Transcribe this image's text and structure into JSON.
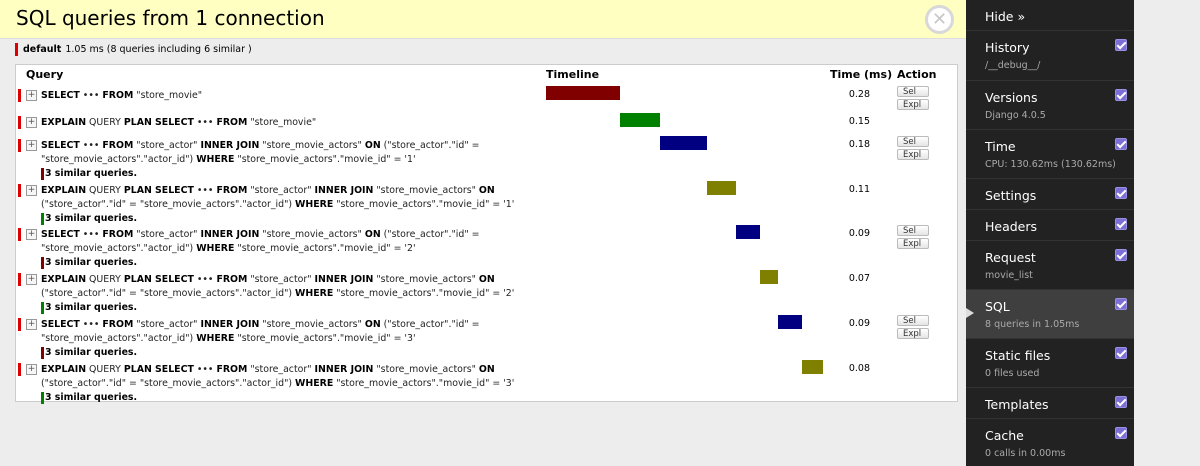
{
  "panel": {
    "title": "SQL queries from 1 connection",
    "close_icon": "close-icon",
    "connection": {
      "alias": "default",
      "summary": "1.05 ms (8 queries including 6 similar )"
    },
    "headers": {
      "query": "Query",
      "timeline": "Timeline",
      "time": "Time (ms)",
      "action": "Action"
    },
    "sel_label": "Sel",
    "expl_label": "Expl",
    "queries": [
      {
        "parts": [
          [
            "b",
            "SELECT"
          ],
          [
            "t",
            " ••• "
          ],
          [
            "b",
            "FROM"
          ],
          [
            "t",
            " \"store_movie\""
          ]
        ],
        "similar": "",
        "time": "0.28",
        "bar_color": "#800000",
        "bar_start": 0.0,
        "bar_end": 0.267,
        "actions": true
      },
      {
        "parts": [
          [
            "b",
            "EXPLAIN"
          ],
          [
            "t",
            " QUERY "
          ],
          [
            "b",
            "PLAN SELECT"
          ],
          [
            "t",
            " ••• "
          ],
          [
            "b",
            "FROM"
          ],
          [
            "t",
            " \"store_movie\""
          ]
        ],
        "similar": "",
        "time": "0.15",
        "bar_color": "#008000",
        "bar_start": 0.267,
        "bar_end": 0.41,
        "actions": false
      },
      {
        "parts": [
          [
            "b",
            "SELECT"
          ],
          [
            "t",
            " ••• "
          ],
          [
            "b",
            "FROM"
          ],
          [
            "t",
            " \"store_actor\" "
          ],
          [
            "b",
            "INNER JOIN"
          ],
          [
            "t",
            " \"store_movie_actors\" "
          ],
          [
            "b",
            "ON"
          ],
          [
            "t",
            " (\"store_actor\".\"id\" = \"store_movie_actors\".\"actor_id\") "
          ],
          [
            "b",
            "WHERE"
          ],
          [
            "t",
            " \"store_movie_actors\".\"movie_id\" = '1'"
          ]
        ],
        "similar": "3 similar queries.",
        "sim_color": "#800000",
        "time": "0.18",
        "bar_color": "#000080",
        "bar_start": 0.41,
        "bar_end": 0.581,
        "actions": true
      },
      {
        "parts": [
          [
            "b",
            "EXPLAIN"
          ],
          [
            "t",
            " QUERY "
          ],
          [
            "b",
            "PLAN SELECT"
          ],
          [
            "t",
            " ••• "
          ],
          [
            "b",
            "FROM"
          ],
          [
            "t",
            " \"store_actor\" "
          ],
          [
            "b",
            "INNER JOIN"
          ],
          [
            "t",
            " \"store_movie_actors\" "
          ],
          [
            "b",
            "ON"
          ],
          [
            "t",
            " (\"store_actor\".\"id\" = \"store_movie_actors\".\"actor_id\") "
          ],
          [
            "b",
            "WHERE"
          ],
          [
            "t",
            " \"store_movie_actors\".\"movie_id\" = '1'"
          ]
        ],
        "similar": "3 similar queries.",
        "sim_color": "#008000",
        "time": "0.11",
        "bar_color": "#808000",
        "bar_start": 0.581,
        "bar_end": 0.686,
        "actions": false
      },
      {
        "parts": [
          [
            "b",
            "SELECT"
          ],
          [
            "t",
            " ••• "
          ],
          [
            "b",
            "FROM"
          ],
          [
            "t",
            " \"store_actor\" "
          ],
          [
            "b",
            "INNER JOIN"
          ],
          [
            "t",
            " \"store_movie_actors\" "
          ],
          [
            "b",
            "ON"
          ],
          [
            "t",
            " (\"store_actor\".\"id\" = \"store_movie_actors\".\"actor_id\") "
          ],
          [
            "b",
            "WHERE"
          ],
          [
            "t",
            " \"store_movie_actors\".\"movie_id\" = '2'"
          ]
        ],
        "similar": "3 similar queries.",
        "sim_color": "#800000",
        "time": "0.09",
        "bar_color": "#000080",
        "bar_start": 0.686,
        "bar_end": 0.771,
        "actions": true
      },
      {
        "parts": [
          [
            "b",
            "EXPLAIN"
          ],
          [
            "t",
            " QUERY "
          ],
          [
            "b",
            "PLAN SELECT"
          ],
          [
            "t",
            " ••• "
          ],
          [
            "b",
            "FROM"
          ],
          [
            "t",
            " \"store_actor\" "
          ],
          [
            "b",
            "INNER JOIN"
          ],
          [
            "t",
            " \"store_movie_actors\" "
          ],
          [
            "b",
            "ON"
          ],
          [
            "t",
            " (\"store_actor\".\"id\" = \"store_movie_actors\".\"actor_id\") "
          ],
          [
            "b",
            "WHERE"
          ],
          [
            "t",
            " \"store_movie_actors\".\"movie_id\" = '2'"
          ]
        ],
        "similar": "3 similar queries.",
        "sim_color": "#008000",
        "time": "0.07",
        "bar_color": "#808000",
        "bar_start": 0.771,
        "bar_end": 0.838,
        "actions": false
      },
      {
        "parts": [
          [
            "b",
            "SELECT"
          ],
          [
            "t",
            " ••• "
          ],
          [
            "b",
            "FROM"
          ],
          [
            "t",
            " \"store_actor\" "
          ],
          [
            "b",
            "INNER JOIN"
          ],
          [
            "t",
            " \"store_movie_actors\" "
          ],
          [
            "b",
            "ON"
          ],
          [
            "t",
            " (\"store_actor\".\"id\" = \"store_movie_actors\".\"actor_id\") "
          ],
          [
            "b",
            "WHERE"
          ],
          [
            "t",
            " \"store_movie_actors\".\"movie_id\" = '3'"
          ]
        ],
        "similar": "3 similar queries.",
        "sim_color": "#800000",
        "time": "0.09",
        "bar_color": "#000080",
        "bar_start": 0.838,
        "bar_end": 0.924,
        "actions": true
      },
      {
        "parts": [
          [
            "b",
            "EXPLAIN"
          ],
          [
            "t",
            " QUERY "
          ],
          [
            "b",
            "PLAN SELECT"
          ],
          [
            "t",
            " ••• "
          ],
          [
            "b",
            "FROM"
          ],
          [
            "t",
            " \"store_actor\" "
          ],
          [
            "b",
            "INNER JOIN"
          ],
          [
            "t",
            " \"store_movie_actors\" "
          ],
          [
            "b",
            "ON"
          ],
          [
            "t",
            " (\"store_actor\".\"id\" = \"store_movie_actors\".\"actor_id\") "
          ],
          [
            "b",
            "WHERE"
          ],
          [
            "t",
            " \"store_movie_actors\".\"movie_id\" = '3'"
          ]
        ],
        "similar": "3 similar queries.",
        "sim_color": "#008000",
        "time": "0.08",
        "bar_color": "#808000",
        "bar_start": 0.924,
        "bar_end": 1.0,
        "actions": false
      }
    ]
  },
  "toolbar": {
    "hide_label": "Hide »",
    "accent": "#7b6fd6",
    "items": [
      {
        "label": "History",
        "sub": "/__debug__/",
        "checked": true,
        "active": false
      },
      {
        "label": "Versions",
        "sub": "Django 4.0.5",
        "checked": true,
        "active": false
      },
      {
        "label": "Time",
        "sub": "CPU: 130.62ms (130.62ms)",
        "checked": true,
        "active": false
      },
      {
        "label": "Settings",
        "sub": "",
        "checked": true,
        "active": false
      },
      {
        "label": "Headers",
        "sub": "",
        "checked": true,
        "active": false
      },
      {
        "label": "Request",
        "sub": "movie_list",
        "checked": true,
        "active": false
      },
      {
        "label": "SQL",
        "sub": "8 queries in 1.05ms",
        "checked": true,
        "active": true
      },
      {
        "label": "Static files",
        "sub": "0 files used",
        "checked": true,
        "active": false
      },
      {
        "label": "Templates",
        "sub": "",
        "checked": true,
        "active": false
      },
      {
        "label": "Cache",
        "sub": "0 calls in 0.00ms",
        "checked": true,
        "active": false
      }
    ]
  }
}
